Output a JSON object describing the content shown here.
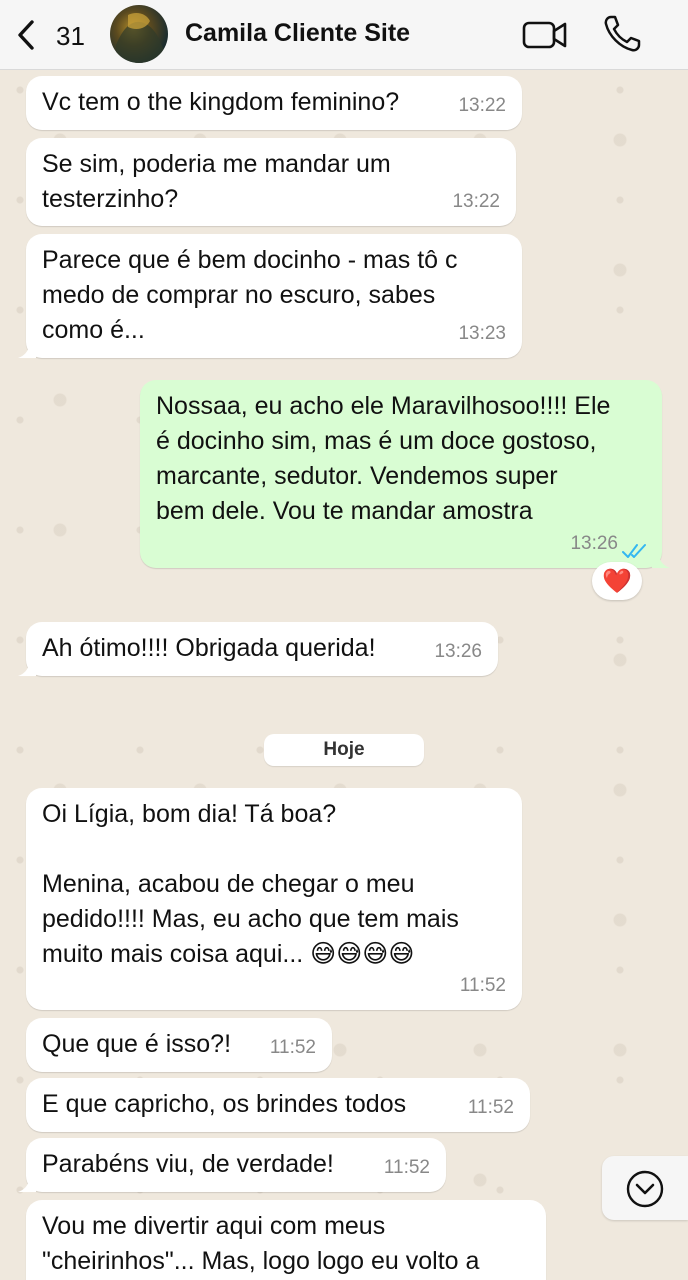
{
  "header": {
    "back_count": "31",
    "contact_name": "Camila Cliente Site",
    "icons": [
      "chevron-left-icon",
      "video-call-icon",
      "phone-icon"
    ]
  },
  "messages": [
    {
      "direction": "in",
      "text": "Vc tem o the kingdom feminino?",
      "time": "13:22"
    },
    {
      "direction": "in",
      "text": "Se sim, poderia me mandar um\ntesterzinho?",
      "time": "13:22"
    },
    {
      "direction": "in",
      "text": "Parece que é bem docinho - mas tô c\nmedo de comprar no escuro, sabes\ncomo é...",
      "time": "13:23"
    },
    {
      "direction": "out",
      "text": "Nossaa, eu acho ele Maravilhosoo!!!! Ele\né docinho sim, mas é um doce gostoso,\nmarcante, sedutor. Vendemos super\nbem dele. Vou te mandar amostra",
      "time": "13:26",
      "status": "read",
      "reaction": "❤️"
    },
    {
      "direction": "in",
      "text": "Ah ótimo!!!! Obrigada querida!",
      "time": "13:26"
    },
    {
      "direction": "in",
      "text": "Oi Lígia, bom dia! Tá boa?\n\nMenina, acabou de chegar o meu\npedido!!!! Mas, eu acho que tem mais\nmuito mais coisa aqui... 😅😅😅😅",
      "time": "11:52"
    },
    {
      "direction": "in",
      "text": "Que que é isso?!",
      "time": "11:52"
    },
    {
      "direction": "in",
      "text": "E que capricho, os brindes todos",
      "time": "11:52"
    },
    {
      "direction": "in",
      "text": "Parabéns viu, de verdade!",
      "time": "11:52"
    },
    {
      "direction": "in",
      "text": "Vou me divertir aqui com meus\n\"cheirinhos\"... Mas, logo logo eu volto a",
      "time": ""
    }
  ],
  "date_separator": "Hoje",
  "colors": {
    "incoming_bubble": "#ffffff",
    "outgoing_bubble": "#d9fdd3",
    "read_ticks": "#34b7f1",
    "reaction_heart": "#e0202a"
  }
}
